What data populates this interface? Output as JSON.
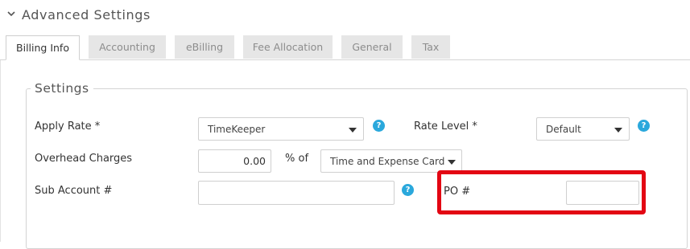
{
  "section": {
    "title": "Advanced Settings",
    "collapse_icon": "chevron-down-icon"
  },
  "tabs": [
    {
      "label": "Billing Info",
      "active": true
    },
    {
      "label": "Accounting",
      "active": false
    },
    {
      "label": "eBilling",
      "active": false
    },
    {
      "label": "Fee Allocation",
      "active": false
    },
    {
      "label": "General",
      "active": false
    },
    {
      "label": "Tax",
      "active": false
    }
  ],
  "settings": {
    "legend": "Settings",
    "apply_rate": {
      "label": "Apply Rate *",
      "value": "TimeKeeper",
      "help_icon": "question-circle-icon"
    },
    "rate_level": {
      "label": "Rate Level *",
      "value": "Default",
      "help_icon": "question-circle-icon"
    },
    "overhead": {
      "label": "Overhead Charges",
      "value": "0.00",
      "unit": "% of",
      "basis": "Time and Expense Card"
    },
    "sub_account": {
      "label": "Sub Account #",
      "value": "",
      "help_icon": "question-circle-icon"
    },
    "po": {
      "label": "PO #",
      "value": ""
    }
  },
  "help_glyph": "?",
  "colors": {
    "accent": "#2aa8dc",
    "highlight": "#e30613",
    "tab_inactive_bg": "#e6e6e6"
  }
}
